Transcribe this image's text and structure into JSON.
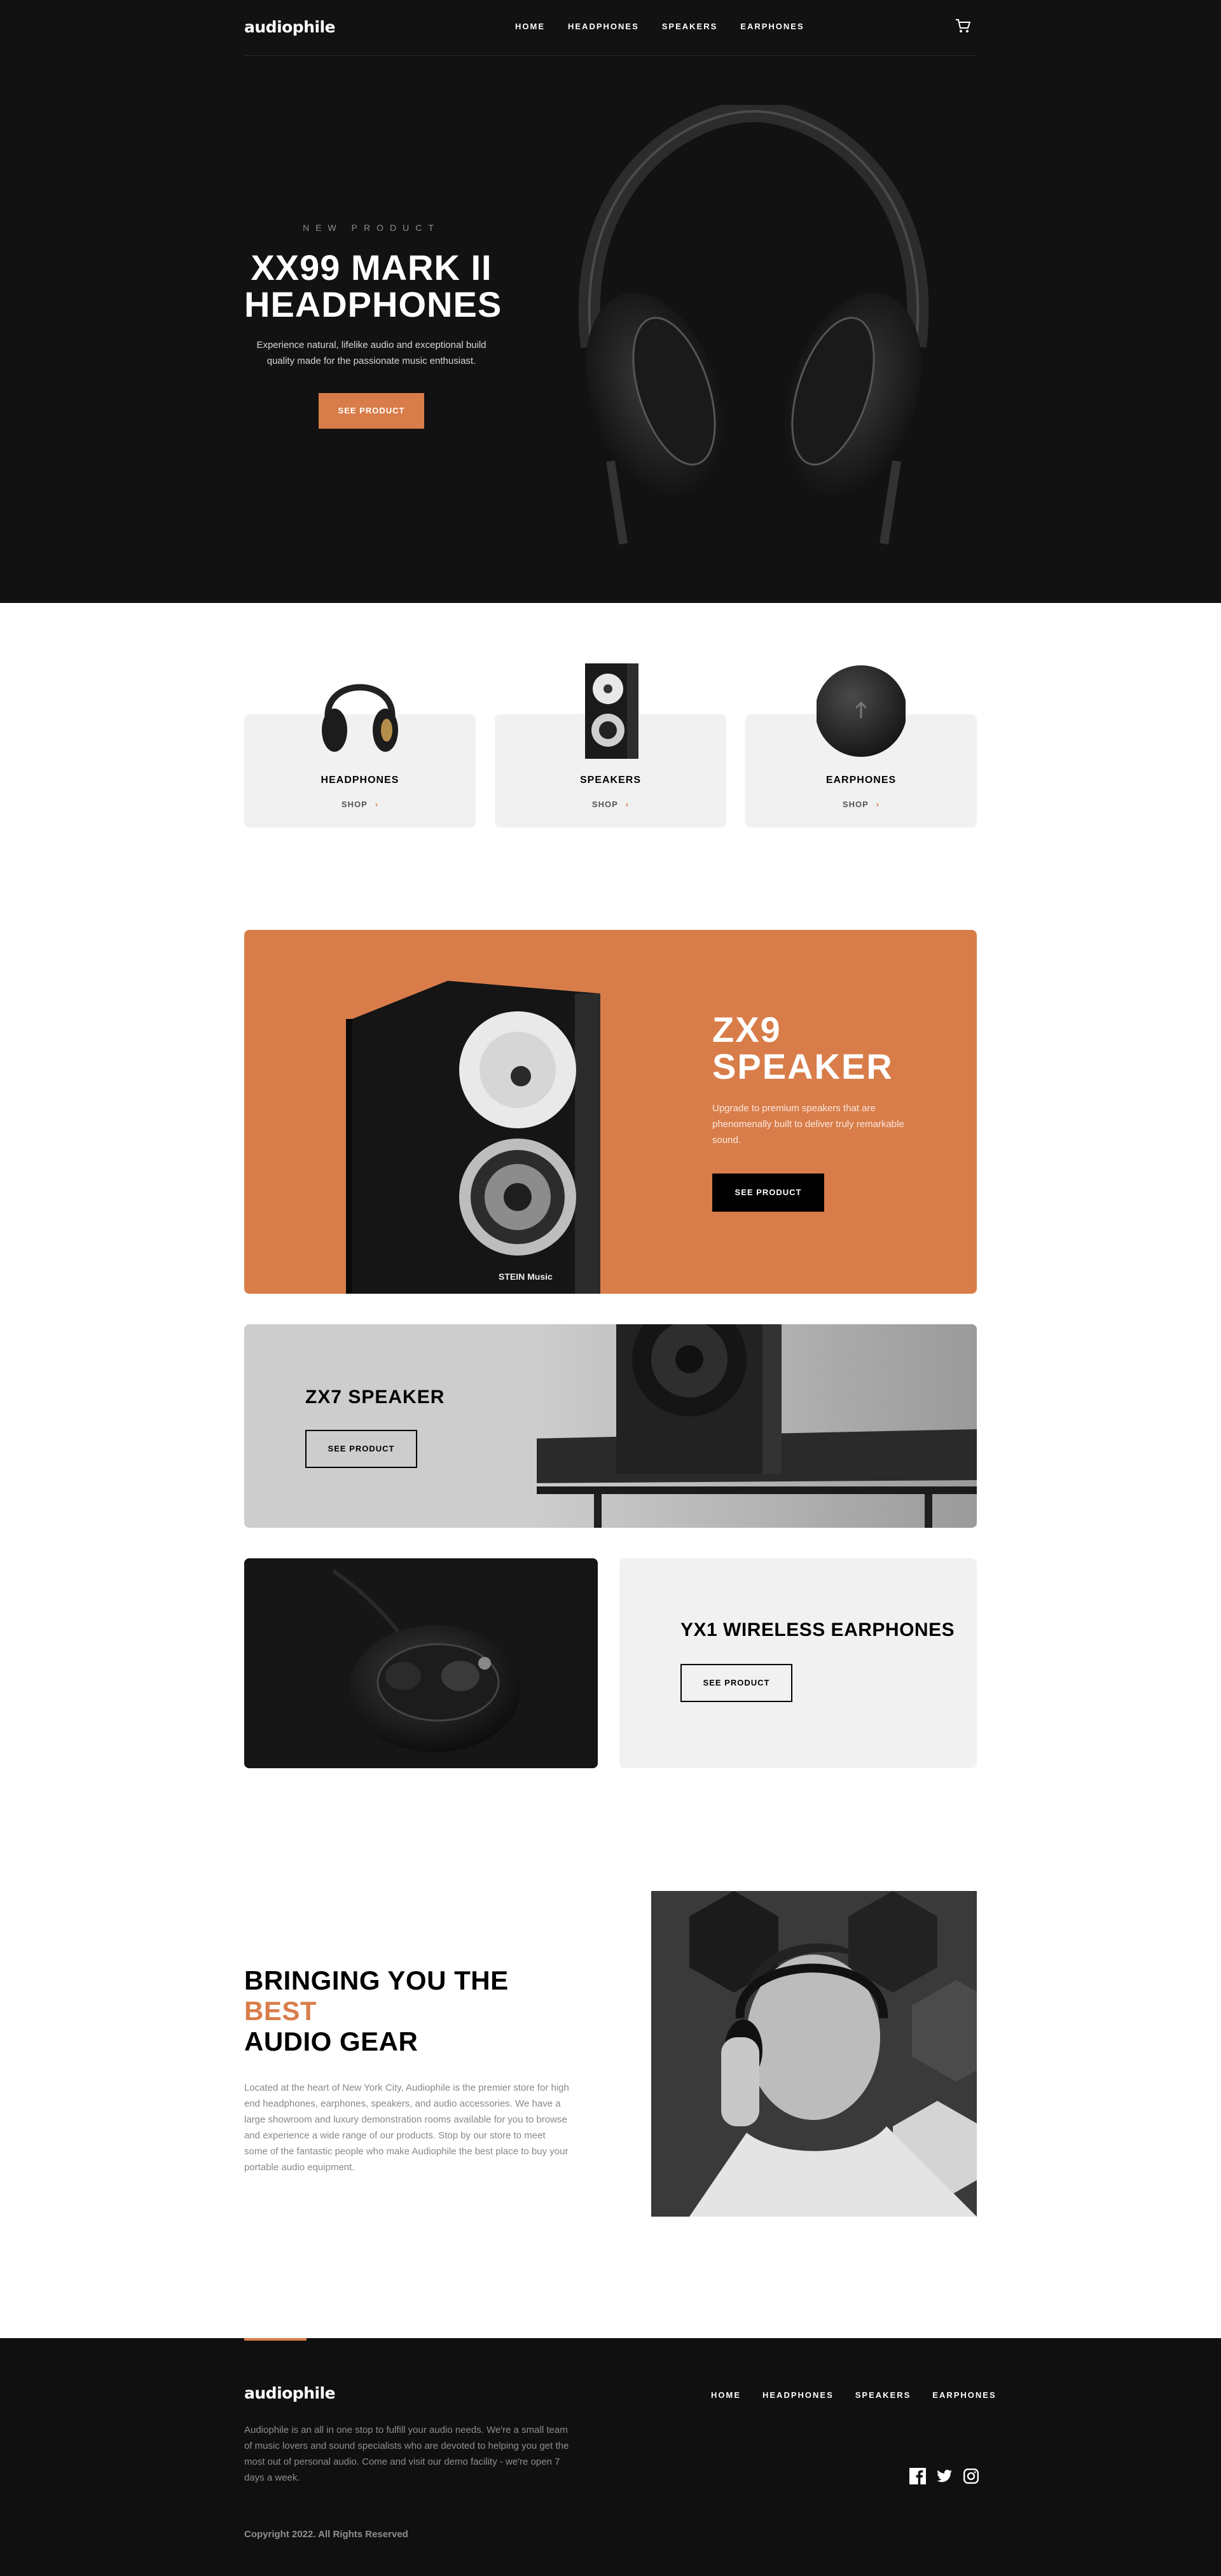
{
  "header": {
    "logo": "audiophile",
    "nav": [
      "HOME",
      "HEADPHONES",
      "SPEAKERS",
      "EARPHONES"
    ],
    "cart_icon": "cart-icon"
  },
  "hero": {
    "overline": "NEW PRODUCT",
    "title_line1": "XX99 MARK II",
    "title_line2": "HEADPHONES",
    "description": "Experience natural, lifelike audio and exceptional build quality made for the passionate music enthusiast.",
    "button": "SEE PRODUCT"
  },
  "categories": [
    {
      "name": "HEADPHONES",
      "shop": "SHOP",
      "icon": "chevron-right-icon"
    },
    {
      "name": "SPEAKERS",
      "shop": "SHOP",
      "icon": "chevron-right-icon"
    },
    {
      "name": "EARPHONES",
      "shop": "SHOP",
      "icon": "chevron-right-icon"
    }
  ],
  "zx9": {
    "title_line1": "ZX9",
    "title_line2": "SPEAKER",
    "description": "Upgrade to premium speakers that are phenomenally built to deliver truly remarkable sound.",
    "button": "SEE PRODUCT",
    "brand_mark": "STEIN Music"
  },
  "zx7": {
    "title": "ZX7 SPEAKER",
    "button": "SEE PRODUCT"
  },
  "yx1": {
    "title": "YX1 WIRELESS EARPHONES",
    "button": "SEE PRODUCT"
  },
  "about": {
    "title_part1": "BRINGING YOU THE ",
    "title_highlight": "BEST",
    "title_part2": "AUDIO GEAR",
    "description": "Located at the heart of New York City, Audiophile is the premier store for high end headphones, earphones, speakers, and audio accessories. We have a large showroom and luxury demonstration rooms available for you to browse and experience a wide range of our products. Stop by our store to meet some of the fantastic people who make Audiophile the best place to buy your portable audio equipment."
  },
  "footer": {
    "logo": "audiophile",
    "nav": [
      "HOME",
      "HEADPHONES",
      "SPEAKERS",
      "EARPHONES"
    ],
    "description": "Audiophile is an all in one stop to fulfill your audio needs. We're a small team of music lovers and sound specialists who are devoted to helping you get the most out of personal audio. Come and visit our demo facility - we're open 7 days a week.",
    "social_icons": [
      "facebook-icon",
      "twitter-icon",
      "instagram-icon"
    ],
    "copyright": "Copyright 2022. All Rights Reserved"
  },
  "colors": {
    "accent": "#d87d4a",
    "dark": "#121212",
    "light_gray": "#f1f1f1"
  }
}
